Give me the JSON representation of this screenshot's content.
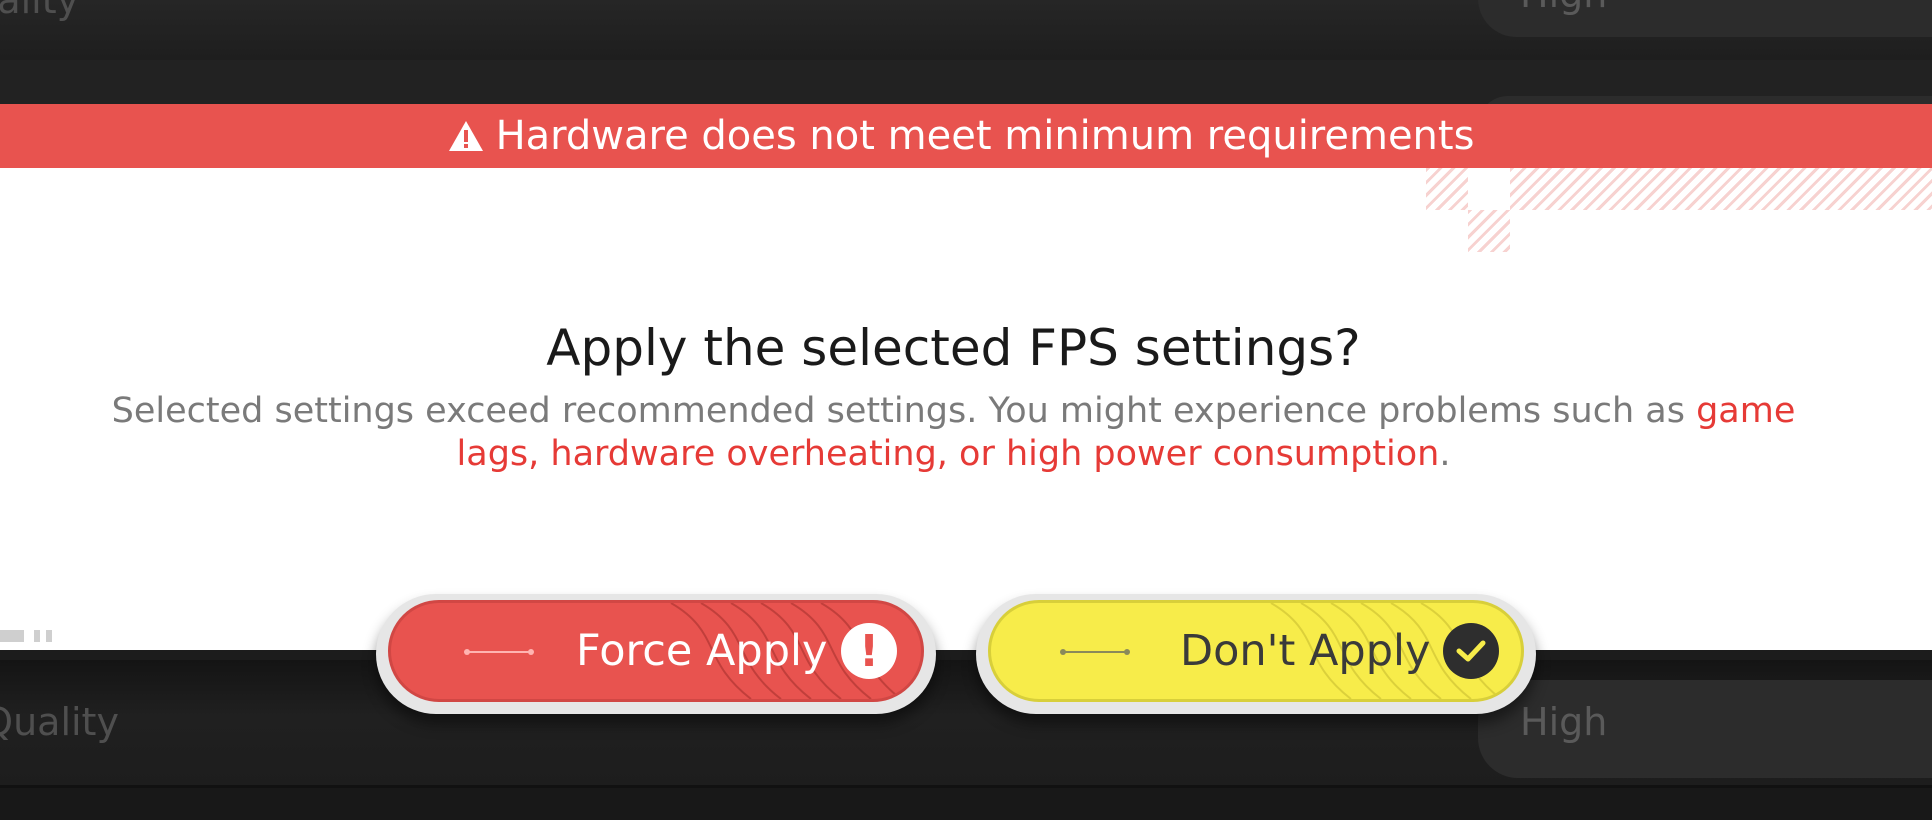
{
  "background": {
    "top_row": {
      "label": "ics Quality",
      "value": "High"
    },
    "bottom_row": {
      "label": "w Quality",
      "value": "High"
    }
  },
  "dialog": {
    "warning": "Hardware does not meet minimum requirements",
    "title": "Apply the selected FPS settings?",
    "body_plain": "Selected settings exceed recommended settings. You might experience problems such as ",
    "body_highlight": "game lags, hardware overheating, or high power consumption",
    "body_end": "."
  },
  "buttons": {
    "force_apply": {
      "label": "Force Apply",
      "icon": "exclamation-icon"
    },
    "dont_apply": {
      "label": "Don't Apply",
      "icon": "check-icon"
    }
  },
  "colors": {
    "warning_red": "#e8534f",
    "highlight_red": "#e63a36",
    "confirm_yellow": "#f7ec4a"
  }
}
